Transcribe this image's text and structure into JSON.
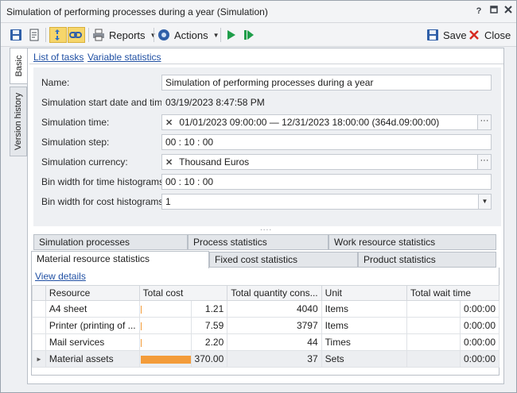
{
  "window": {
    "title": "Simulation of performing processes during a year (Simulation)",
    "help_label": "?"
  },
  "toolbar": {
    "reports_label": "Reports",
    "actions_label": "Actions",
    "save_label": "Save",
    "close_label": "Close"
  },
  "side_tabs": [
    "Basic",
    "Version history"
  ],
  "links": {
    "list_of_tasks": "List of tasks",
    "variable_statistics": "Variable statistics"
  },
  "form": {
    "name_label": "Name:",
    "name_value": "Simulation of performing processes during a year",
    "start_label": "Simulation start date and time:",
    "start_value": "03/19/2023 8:47:58 PM",
    "time_label": "Simulation time:",
    "time_value": "01/01/2023 09:00:00 — 12/31/2023 18:00:00 (364d.09:00:00)",
    "step_label": "Simulation step:",
    "step_value": "00 : 10 : 00",
    "currency_label": "Simulation currency:",
    "currency_value": "Thousand Euros",
    "bin_time_label": "Bin width for time histograms:",
    "bin_time_value": "00 : 10 : 00",
    "bin_cost_label": "Bin width for cost histograms:",
    "bin_cost_value": "1"
  },
  "tabs_row1": [
    "Simulation processes",
    "Process statistics",
    "Work resource statistics"
  ],
  "tabs_row2": [
    "Material resource statistics",
    "Fixed cost statistics",
    "Product statistics"
  ],
  "active_tab": "Material resource statistics",
  "view_details": "View details",
  "table": {
    "columns": [
      "Resource",
      "Total cost",
      "Total quantity cons...",
      "Unit",
      "Total wait time"
    ],
    "rows": [
      {
        "resource": "A4 sheet",
        "cost": "1.21",
        "cost_fraction": 0.0033,
        "quantity": "4040",
        "unit": "Items",
        "wait": "0:00:00"
      },
      {
        "resource": "Printer (printing of ...",
        "cost": "7.59",
        "cost_fraction": 0.0205,
        "quantity": "3797",
        "unit": "Items",
        "wait": "0:00:00"
      },
      {
        "resource": "Mail services",
        "cost": "2.20",
        "cost_fraction": 0.0059,
        "quantity": "44",
        "unit": "Times",
        "wait": "0:00:00"
      },
      {
        "resource": "Material assets",
        "cost": "370.00",
        "cost_fraction": 1.0,
        "quantity": "37",
        "unit": "Sets",
        "wait": "0:00:00"
      }
    ]
  },
  "colors": {
    "bar": "#f39c3a",
    "link": "#1f4fa3",
    "toggle": "#f6d66b"
  }
}
